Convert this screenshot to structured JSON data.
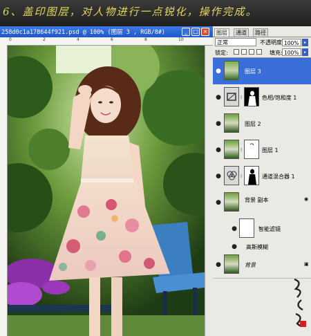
{
  "banner": {
    "text": "6、盖印图层，对人物进行一点锐化，操作完成。"
  },
  "document": {
    "title": "258d0c1a178644f921.psd @ 100% (图层 3 , RGB/8#)",
    "min_symbol": "_",
    "max_symbol": "□",
    "close_symbol": "×",
    "ruler_numbers": [
      "0",
      "2",
      "4",
      "6",
      "8",
      "10"
    ]
  },
  "panel": {
    "tabs": [
      "图层",
      "通道",
      "路径"
    ],
    "blend_mode": "正常",
    "opacity_label": "不透明度:",
    "opacity_value": "100%",
    "lock_label": "锁定:",
    "fill_label": "填充:",
    "fill_value": "100%",
    "arrow_symbol": "▸",
    "layers": [
      {
        "name": "图层 3",
        "selected": true,
        "has_mask": false
      },
      {
        "name": "色相/饱和度 1",
        "selected": false,
        "has_mask": true
      },
      {
        "name": "图层 2",
        "selected": false,
        "has_mask": false
      },
      {
        "name": "图层 1",
        "selected": false,
        "has_mask": true
      },
      {
        "name": "通道混合器 1",
        "selected": false,
        "has_mask": true
      },
      {
        "name": "背景 副本",
        "selected": false,
        "has_mask": false
      },
      {
        "name": "智能滤镜",
        "selected": false,
        "has_mask": true
      },
      {
        "name": "高斯模糊",
        "selected": false,
        "has_mask": false
      },
      {
        "name": "背景",
        "selected": false,
        "has_mask": false
      }
    ]
  },
  "colors": {
    "banner_text": "#e7d45a",
    "title_bar": "#2a63d6",
    "selection": "#3a6fd9"
  },
  "icons": {
    "eye": "eye-icon",
    "lock": "lock-icon",
    "chain": "chain-link-icon",
    "smart_object": "smart-object-icon"
  }
}
